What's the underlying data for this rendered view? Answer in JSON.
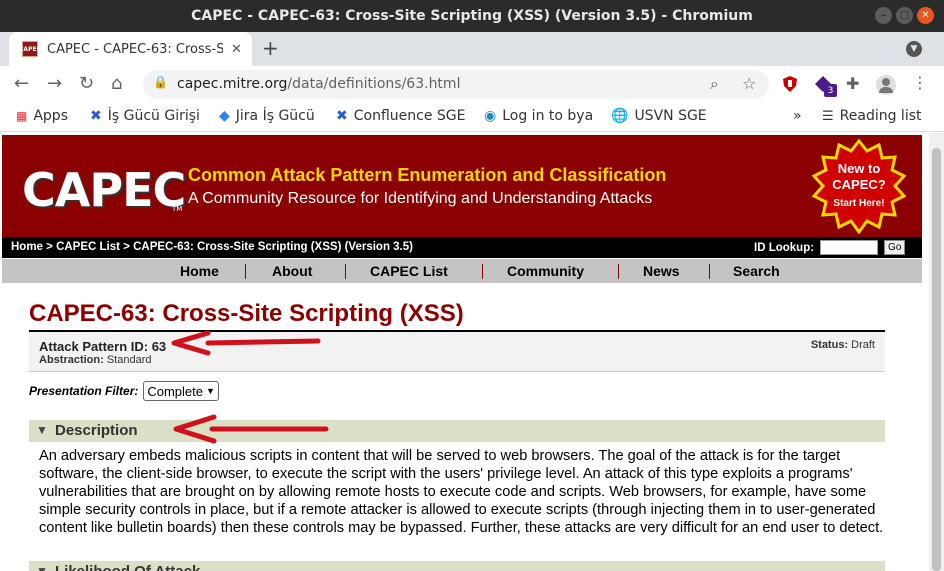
{
  "window": {
    "title": "CAPEC - CAPEC-63: Cross-Site Scripting (XSS) (Version 3.5) - Chromium"
  },
  "tab": {
    "title": "CAPEC - CAPEC-63: Cross-S",
    "favicon_text": "CAPEC"
  },
  "address": {
    "url_host": "capec.mitre.org",
    "url_path": "/data/definitions/63.html"
  },
  "extensions": {
    "badge_count": "3"
  },
  "bookmarks": {
    "items": [
      {
        "label": "Apps",
        "icon": "apps-grid-icon"
      },
      {
        "label": "İş Gücü Girişi",
        "icon": "confluence-icon"
      },
      {
        "label": "Jira İş Gücü",
        "icon": "jira-icon"
      },
      {
        "label": "Confluence SGE",
        "icon": "confluence-icon"
      },
      {
        "label": "Log in to bya",
        "icon": "bya-icon"
      },
      {
        "label": "USVN SGE",
        "icon": "globe-icon"
      }
    ],
    "overflow": "»",
    "reading_list": "Reading list"
  },
  "header": {
    "logo": "CAPEC",
    "tm": "TM",
    "title": "Common Attack Pattern Enumeration and Classification",
    "subtitle": "A Community Resource for Identifying and Understanding Attacks",
    "badge_line1": "New to",
    "badge_line2": "CAPEC?",
    "badge_line3": "Start Here!"
  },
  "breadcrumb": {
    "home": "Home",
    "sep1": " > ",
    "list": "CAPEC List",
    "sep2": " > ",
    "current": "CAPEC-63: Cross-Site Scripting (XSS) (Version 3.5)",
    "id_lookup": "ID Lookup:",
    "go": "Go"
  },
  "menu": [
    "Home",
    "About",
    "CAPEC List",
    "Community",
    "News",
    "Search"
  ],
  "content": {
    "heading": "CAPEC-63: Cross-Site Scripting (XSS)",
    "attack_pattern_id": "Attack Pattern ID: 63",
    "abstraction_label": "Abstraction:",
    "abstraction_value": " Standard",
    "status_label": "Status:",
    "status_value": " Draft",
    "presentation_filter_label": "Presentation Filter:",
    "presentation_filter_value": "Complete",
    "description_title": "Description",
    "description_text": "An adversary embeds malicious scripts in content that will be served to web browsers. The goal of the attack is for the target software, the client-side browser, to execute the script with the users' privilege level. An attack of this type exploits a programs' vulnerabilities that are brought on by allowing remote hosts to execute code and scripts. Web browsers, for example, have some simple security controls in place, but if a remote attacker is allowed to execute scripts (through injecting them in to user-generated content like bulletin boards) then these controls may be bypassed. Further, these attacks are very difficult for an end user to detect.",
    "likelihood_title": "Likelihood Of Attack"
  },
  "colors": {
    "capec_red": "#8b0000",
    "heading_gold": "#ffd700",
    "annotation_arrow": "#d0101a"
  }
}
